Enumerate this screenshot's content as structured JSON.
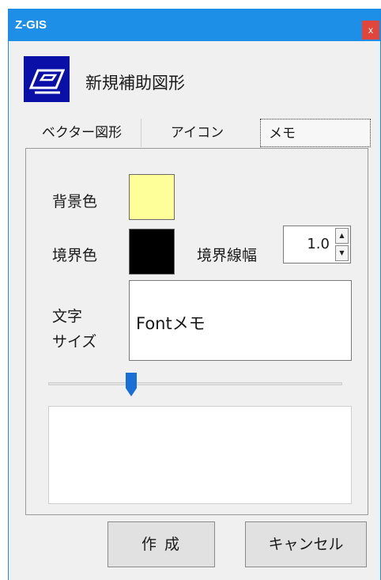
{
  "window": {
    "title": "Z-GIS",
    "close_label": "x"
  },
  "header": {
    "title": "新規補助図形",
    "icon": "shape-outline-icon"
  },
  "tabs": [
    {
      "label": "ベクター図形"
    },
    {
      "label": "アイコン"
    },
    {
      "label": "メモ",
      "selected": true
    }
  ],
  "memo": {
    "background_color_label": "背景色",
    "background_color": "#ffff99",
    "border_color_label": "境界色",
    "border_color": "#000000",
    "border_width_label": "境界線幅",
    "border_width_value": "1.0",
    "font_size_label_line1": "文字",
    "font_size_label_line2": "サイズ",
    "font_preview_text": "Fontメモ",
    "memo_text": ""
  },
  "buttons": {
    "create": "作成",
    "cancel": "キャンセル"
  },
  "colors": {
    "titlebar": "#1e8fe6",
    "close": "#e0463b",
    "icon_bg": "#0a0fa8",
    "slider": "#1a6fd6"
  }
}
